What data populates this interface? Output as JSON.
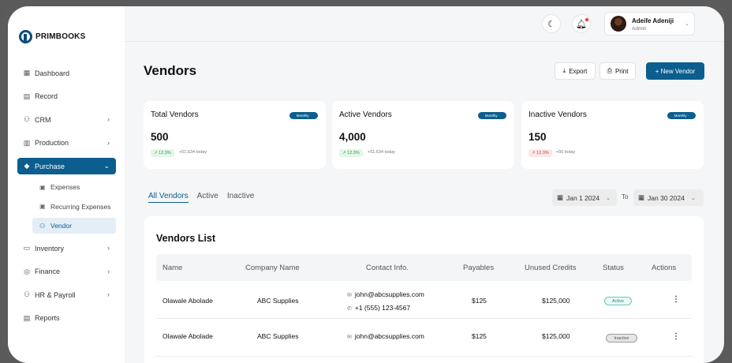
{
  "brand": {
    "name": "PRIMBOOKS"
  },
  "sidebar": {
    "items": [
      {
        "label": "Dashboard",
        "icon": "grid-icon"
      },
      {
        "label": "Record",
        "icon": "stack-icon"
      },
      {
        "label": "CRM",
        "icon": "people-icon"
      },
      {
        "label": "Production",
        "icon": "factory-icon"
      },
      {
        "label": "Purchase",
        "icon": "tag-icon"
      },
      {
        "label": "Inventory",
        "icon": "box-icon"
      },
      {
        "label": "Finance",
        "icon": "money-icon"
      },
      {
        "label": "HR & Payroll",
        "icon": "team-icon"
      },
      {
        "label": "Reports",
        "icon": "report-icon"
      }
    ],
    "purchase_sub": [
      {
        "label": "Expenses"
      },
      {
        "label": "Recurring Expenses"
      },
      {
        "label": "Vendor"
      }
    ]
  },
  "header": {
    "user_name": "Adeife Adeniji",
    "user_role": "Admin"
  },
  "page": {
    "title": "Vendors",
    "export_label": "Export",
    "print_label": "Print",
    "new_label": "+  New Vendor"
  },
  "stats": [
    {
      "title": "Total Vendors",
      "period": "Monthly  ·",
      "value": "500",
      "delta": "↗ 12.3%",
      "note": "+51,634 today",
      "trend": "up"
    },
    {
      "title": "Active Vendors",
      "period": "Monthly  ·",
      "value": "4,000",
      "delta": "↗ 12.3%",
      "note": "+51,634 today",
      "trend": "up"
    },
    {
      "title": "Inactive  Vendors",
      "period": "Monthly  ·",
      "value": "150",
      "delta": "↗ 12.3%",
      "note": "+50 today",
      "trend": "down"
    }
  ],
  "tabs": [
    "All Vendors",
    "Active",
    "Inactive"
  ],
  "filters": {
    "from": "Jan 1 2024",
    "to_label": "To",
    "to": "Jan 30 2024"
  },
  "table": {
    "title": "Vendors List",
    "columns": [
      "Name",
      "Company Name",
      "Contact Info.",
      "Payables",
      "Unused Credits",
      "Status",
      "Actions"
    ],
    "rows": [
      {
        "name": "Olawale Abolade",
        "company": "ABC Supplies",
        "email": "john@abcsupplies.com",
        "phone": "+1 (555) 123-4567",
        "payables": "$125",
        "credits": "$125,000",
        "status": "Active",
        "actions": "⋮"
      },
      {
        "name": "Olawale Abolade",
        "company": "ABC Supplies",
        "email": "john@abcsupplies.com",
        "phone": "",
        "payables": "$125",
        "credits": "$125,000",
        "status": "Inactive",
        "actions": "⋮"
      }
    ]
  },
  "colors": {
    "primary": "#0b5e8e",
    "up": "#2e9a4a",
    "down": "#d13b3b"
  }
}
